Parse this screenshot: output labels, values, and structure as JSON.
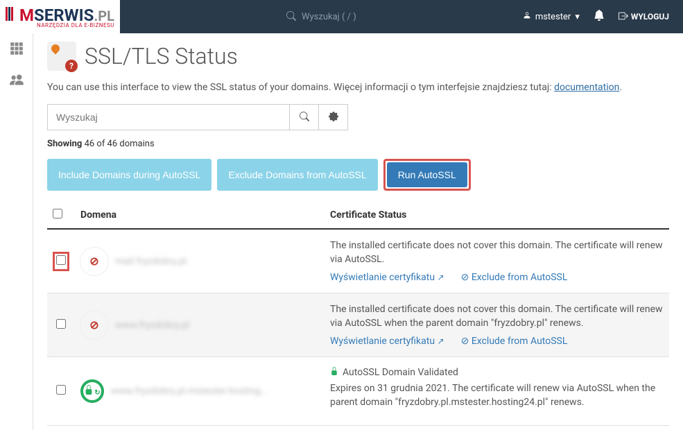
{
  "header": {
    "logo_main": "SERWIS",
    "logo_suffix": ".PL",
    "logo_subtitle": "NARZĘDZIA DLA E-BIZNESU",
    "search_placeholder": "Wyszukaj ( / )",
    "username": "mstester",
    "logout_label": "WYLOGUJ"
  },
  "page": {
    "title": "SSL/TLS Status",
    "intro_part1": "You can use this interface to view the SSL status of your domains. Więcej informacji o tym interfejsie znajdziesz tutaj: ",
    "intro_link": "documentation",
    "intro_part2": ".",
    "search_placeholder": "Wyszukaj",
    "showing_label": "Showing",
    "showing_count": "46 of 46 domains",
    "btn_include": "Include Domains during AutoSSL",
    "btn_exclude": "Exclude Domains from AutoSSL",
    "btn_run": "Run AutoSSL"
  },
  "table": {
    "col_domain": "Domena",
    "col_status": "Certificate Status",
    "rows": [
      {
        "domain": "mail.fryzdobry.pl",
        "status_type": "error",
        "status_text": "The installed certificate does not cover this domain. The certificate will renew via AutoSSL.",
        "view_cert_label": "Wyświetlanie certyfikatu",
        "exclude_label": "Exclude from AutoSSL",
        "highlighted": true
      },
      {
        "domain": "www.fryzdobry.pl",
        "status_type": "error",
        "status_text": "The installed certificate does not cover this domain. The certificate will renew via AutoSSL when the parent domain \"fryzdobry.pl\" renews.",
        "view_cert_label": "Wyświetlanie certyfikatu",
        "exclude_label": "Exclude from AutoSSL",
        "highlighted": false
      },
      {
        "domain": "www.fryzdobry.pl.mstester.hosting...",
        "status_type": "ok",
        "validated_label": "AutoSSL Domain Validated",
        "status_text": "Expires on 31 grudnia 2021. The certificate will renew via AutoSSL when the parent domain \"fryzdobry.pl.mstester.hosting24.pl\" renews.",
        "highlighted": false
      }
    ]
  }
}
